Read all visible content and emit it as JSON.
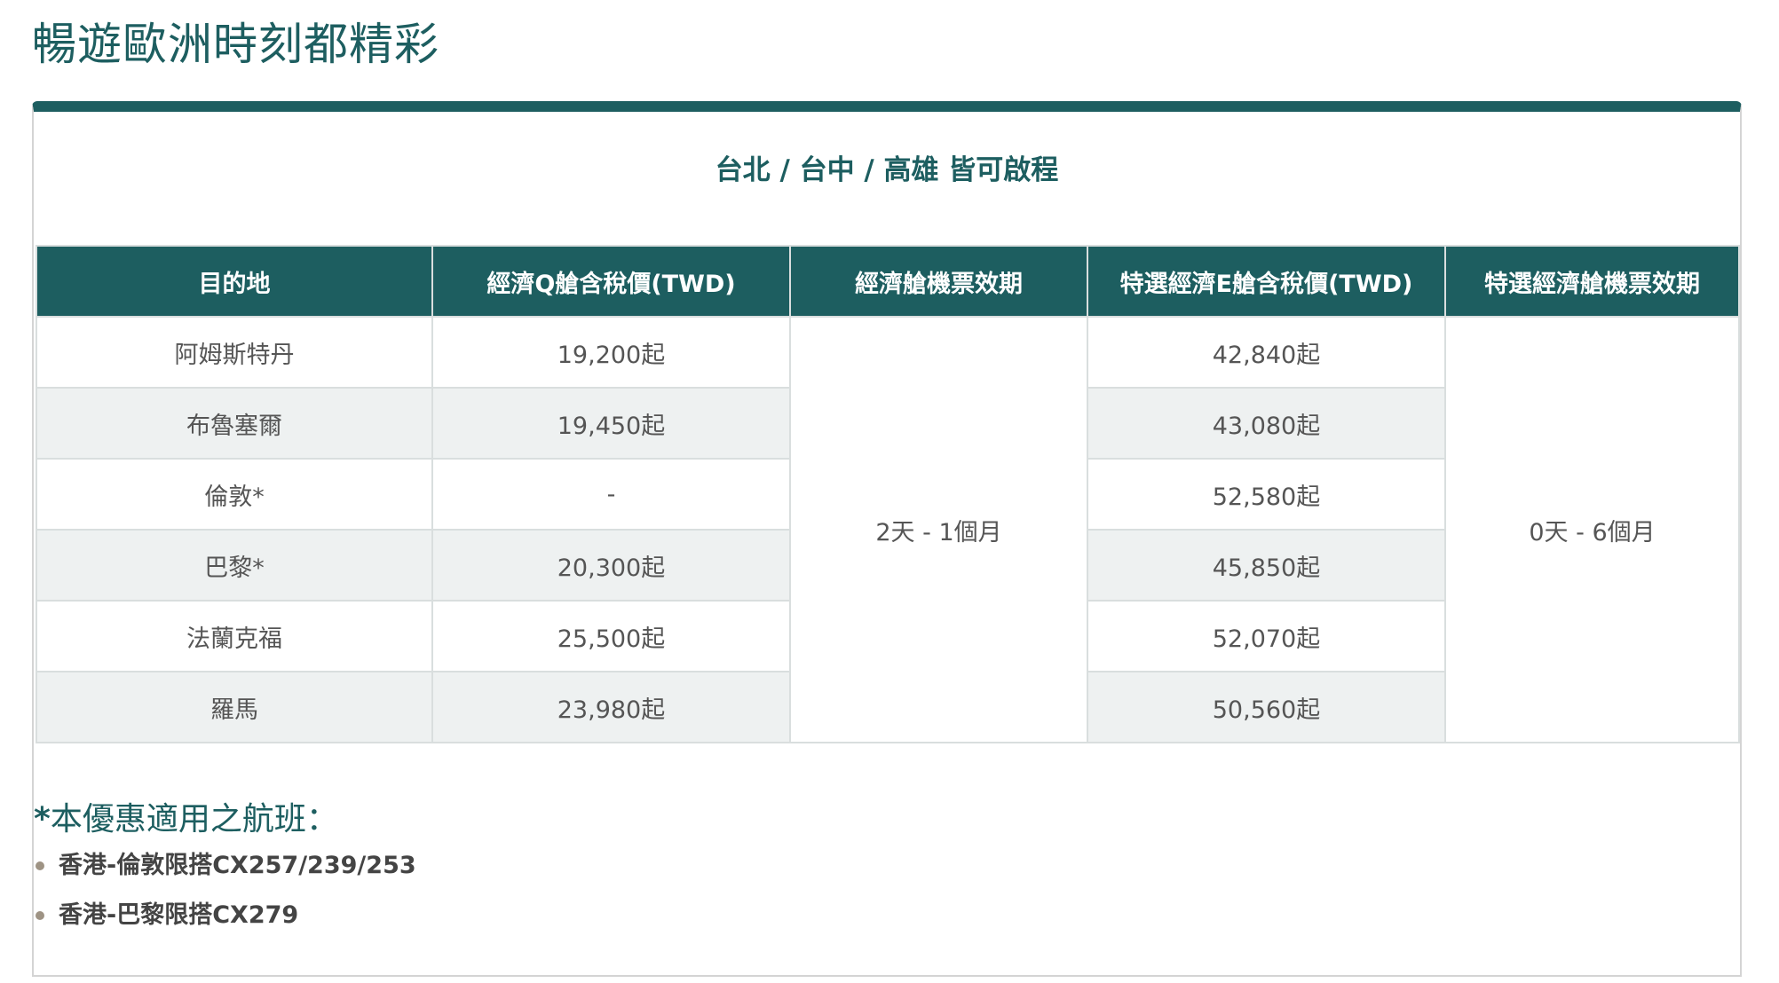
{
  "page": {
    "title": "暢遊歐洲時刻都精彩"
  },
  "card": {
    "heading": "台北 / 台中 / 高雄 皆可啟程"
  },
  "table": {
    "headers": [
      "目的地",
      "經濟Q艙含稅價(TWD)",
      "經濟艙機票效期",
      "特選經濟E艙含稅價(TWD)",
      "特選經濟艙機票效期"
    ],
    "rows": [
      {
        "destination": "阿姆斯特丹",
        "economy_price": "19,200起",
        "premium_price": "42,840起"
      },
      {
        "destination": "布魯塞爾",
        "economy_price": "19,450起",
        "premium_price": "43,080起"
      },
      {
        "destination": "倫敦*",
        "economy_price": "-",
        "premium_price": "52,580起"
      },
      {
        "destination": "巴黎*",
        "economy_price": "20,300起",
        "premium_price": "45,850起"
      },
      {
        "destination": "法蘭克福",
        "economy_price": "25,500起",
        "premium_price": "52,070起"
      },
      {
        "destination": "羅馬",
        "economy_price": "23,980起",
        "premium_price": "50,560起"
      }
    ],
    "economy_validity": "2天 - 1個月",
    "premium_validity": "0天 - 6個月"
  },
  "notes": {
    "star": "*",
    "title": "本優惠適用之航班：",
    "items": [
      "香港-倫敦限搭CX257/239/253",
      "香港-巴黎限搭CX279"
    ]
  },
  "colors": {
    "brand": "#1d5e60",
    "stripe": "#eef1f1",
    "bullet": "#9e9384"
  }
}
